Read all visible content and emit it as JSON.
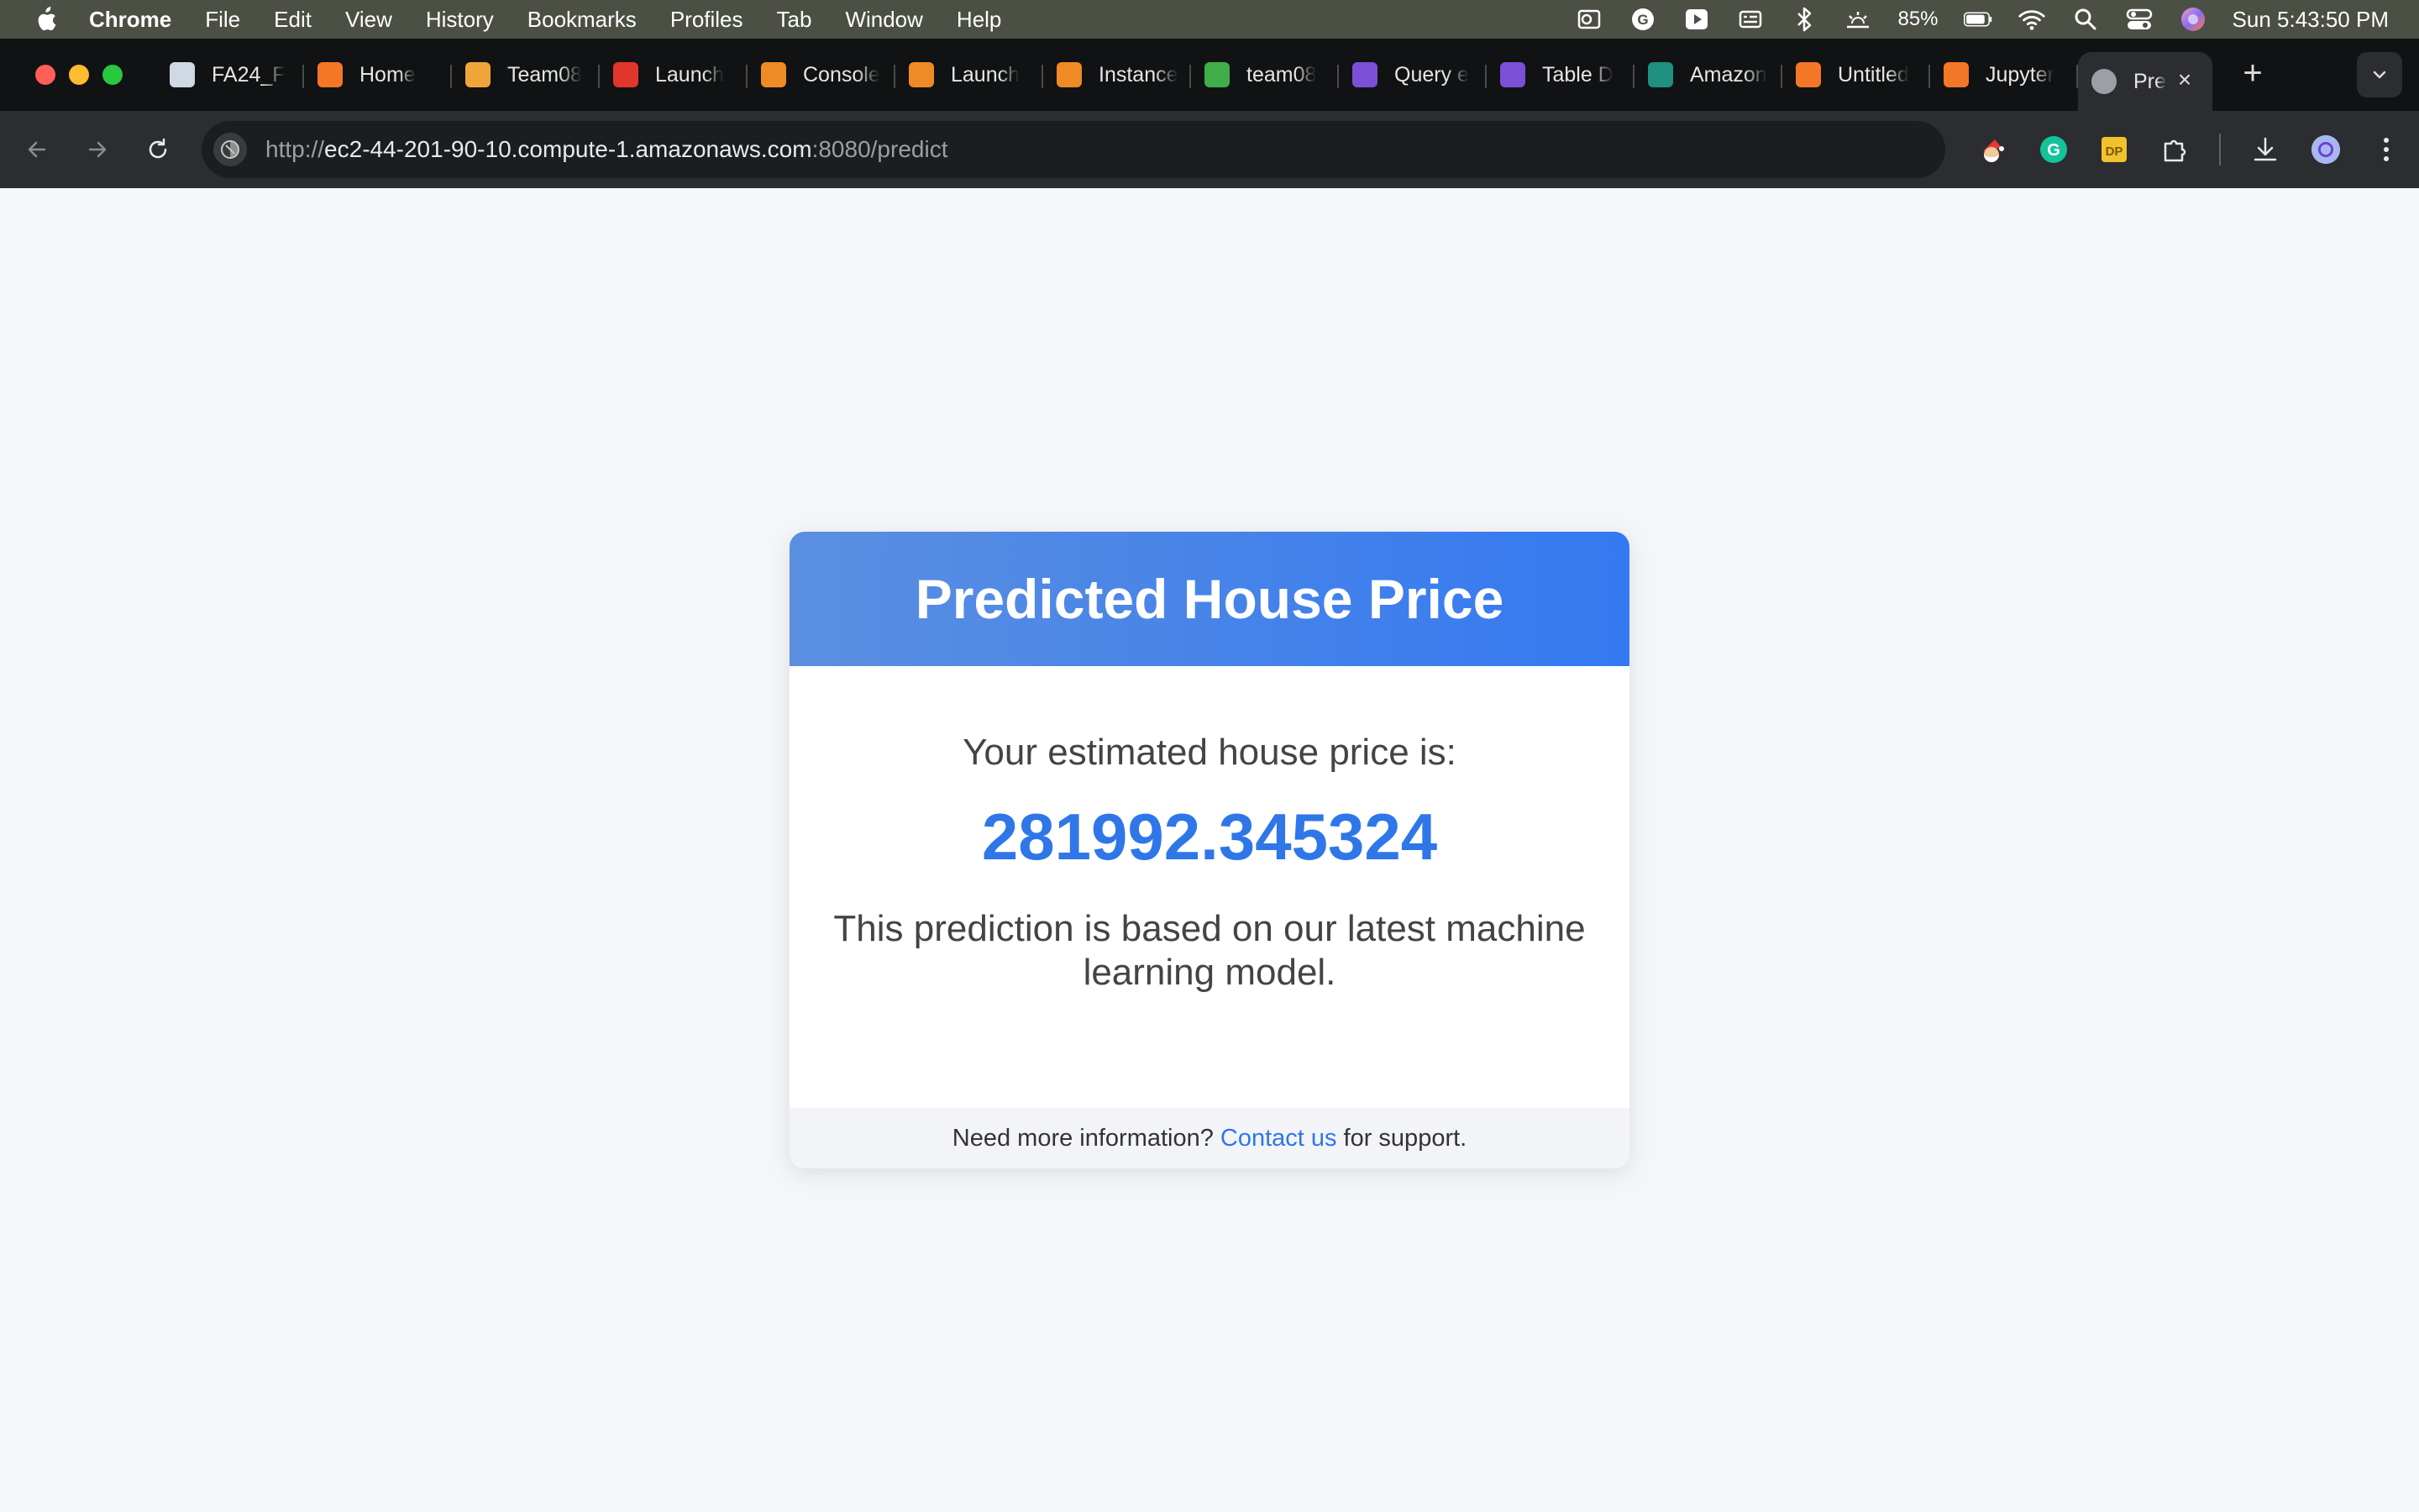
{
  "menubar": {
    "app": "Chrome",
    "items": [
      "File",
      "Edit",
      "View",
      "History",
      "Bookmarks",
      "Profiles",
      "Tab",
      "Window",
      "Help"
    ],
    "battery": "85%",
    "clock": "Sun 5:43:50 PM"
  },
  "tabs": [
    {
      "label": "FA24_F",
      "icon": "compass-icon",
      "color": "#cfd8e3"
    },
    {
      "label": "Home",
      "icon": "jupyter-icon",
      "color": "#f37726"
    },
    {
      "label": "Team08",
      "icon": "notebook-icon",
      "color": "#f0a53a"
    },
    {
      "label": "Launch",
      "icon": "canvas-icon",
      "color": "#e0362c"
    },
    {
      "label": "Console",
      "icon": "aws-box-icon",
      "color": "#f08a24"
    },
    {
      "label": "Launch",
      "icon": "ec2-icon",
      "color": "#f08a24"
    },
    {
      "label": "Instance",
      "icon": "ec2-icon",
      "color": "#f08a24"
    },
    {
      "label": "team08",
      "icon": "bucket-icon",
      "color": "#3fae49"
    },
    {
      "label": "Query e",
      "icon": "athena-icon",
      "color": "#7b4fd6"
    },
    {
      "label": "Table D",
      "icon": "glue-icon",
      "color": "#7b4fd6"
    },
    {
      "label": "Amazon",
      "icon": "sagemaker-icon",
      "color": "#1f8f7f"
    },
    {
      "label": "Untitled",
      "icon": "hourglass-icon",
      "color": "#f37726"
    },
    {
      "label": "Jupyter",
      "icon": "jupyter-icon",
      "color": "#f37726"
    },
    {
      "label": "Pre",
      "icon": "globe-icon",
      "color": "#9aa0a6"
    }
  ],
  "toolbar": {
    "url_scheme": "http://",
    "url_host": "ec2-44-201-90-10.compute-1.amazonaws.com",
    "url_rest": ":8080/predict"
  },
  "card": {
    "title": "Predicted House Price",
    "subtitle": "Your estimated house price is:",
    "price": "281992.345324",
    "note": "This prediction is based on our latest machine learning model.",
    "footer_prefix": "Need more information?",
    "footer_link": "Contact us",
    "footer_suffix": "for support."
  },
  "colors": {
    "accent": "#3479f1",
    "header_start": "#5b8fe0",
    "price": "#2f76e8",
    "page_bg": "#f5f6fa"
  }
}
